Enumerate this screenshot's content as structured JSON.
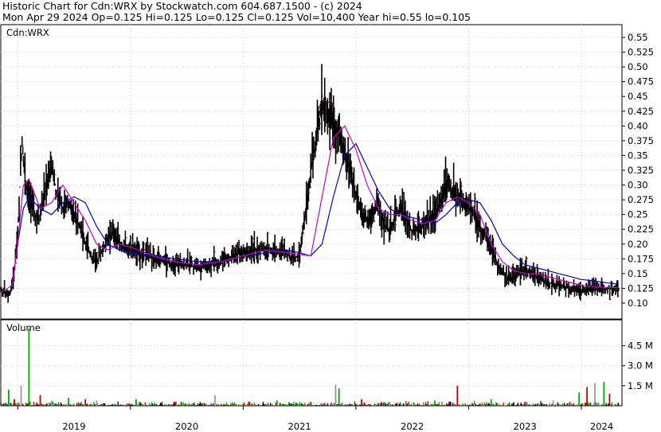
{
  "header": {
    "line1": "Historic Chart for Cdn:WRX by Stockwatch.com 604.687.1500 - (c) 2024",
    "line2": "Mon Apr 29 2024   Op=0.125  Hi=0.125  Lo=0.125  Cl=0.125  Vol=10,400  Year hi=0.55  lo=0.105"
  },
  "colors": {
    "background": "#ffffff",
    "grid": "#c8c8c8",
    "bar_up": "#000000",
    "bar_close": "#cc0000",
    "ma_short": "#cc00cc",
    "ma_long": "#0000cc",
    "vol_up": "#00aa00",
    "vol_down": "#cc0000",
    "vol_flat": "#999999"
  },
  "chart_data": [
    {
      "type": "line",
      "legend_label": "Cdn:WRX",
      "y_ticks": [
        "0.55",
        "0.525",
        "0.50",
        "0.475",
        "0.45",
        "0.425",
        "0.40",
        "0.375",
        "0.35",
        "0.325",
        "0.30",
        "0.275",
        "0.25",
        "0.225",
        "0.20",
        "0.175",
        "0.15",
        "0.125",
        "0.10"
      ],
      "ylim": [
        0.09,
        0.565
      ],
      "x_ticks": [
        "2019",
        "2020",
        "2021",
        "2022",
        "2023",
        "2024"
      ],
      "xlim": [
        2018.85,
        2024.36
      ],
      "grid": true,
      "price_series": {
        "x": [
          2018.85,
          2018.93,
          2018.97,
          2019.0,
          2019.02,
          2019.04,
          2019.06,
          2019.09,
          2019.12,
          2019.15,
          2019.2,
          2019.25,
          2019.3,
          2019.35,
          2019.4,
          2019.45,
          2019.5,
          2019.55,
          2019.6,
          2019.65,
          2019.7,
          2019.75,
          2019.8,
          2019.85,
          2019.9,
          2019.95,
          2020.0,
          2020.05,
          2020.1,
          2020.15,
          2020.2,
          2020.3,
          2020.4,
          2020.5,
          2020.6,
          2020.7,
          2020.8,
          2020.9,
          2021.0,
          2021.1,
          2021.2,
          2021.3,
          2021.35,
          2021.4,
          2021.45,
          2021.5,
          2021.6,
          2021.7,
          2021.8,
          2021.85,
          2021.9,
          2021.95,
          2021.98,
          2022.02,
          2022.05,
          2022.1,
          2022.15,
          2022.2,
          2022.25,
          2022.3,
          2022.35,
          2022.4,
          2022.5,
          2022.6,
          2022.7,
          2022.8,
          2022.9,
          2023.0,
          2023.05,
          2023.1,
          2023.15,
          2023.2,
          2023.25,
          2023.3,
          2023.35,
          2023.4,
          2023.45,
          2023.5,
          2023.55,
          2023.6,
          2023.65,
          2023.7,
          2023.8,
          2023.9,
          2024.0,
          2024.1,
          2024.2,
          2024.3,
          2024.33
        ],
        "y": [
          0.12,
          0.115,
          0.15,
          0.22,
          0.3,
          0.38,
          0.32,
          0.28,
          0.27,
          0.25,
          0.24,
          0.3,
          0.33,
          0.28,
          0.26,
          0.27,
          0.25,
          0.23,
          0.2,
          0.18,
          0.17,
          0.19,
          0.21,
          0.22,
          0.2,
          0.19,
          0.19,
          0.185,
          0.18,
          0.18,
          0.175,
          0.17,
          0.165,
          0.165,
          0.16,
          0.165,
          0.17,
          0.18,
          0.185,
          0.19,
          0.19,
          0.185,
          0.19,
          0.18,
          0.175,
          0.18,
          0.32,
          0.44,
          0.4,
          0.38,
          0.35,
          0.33,
          0.3,
          0.27,
          0.25,
          0.24,
          0.25,
          0.27,
          0.23,
          0.22,
          0.25,
          0.26,
          0.22,
          0.23,
          0.25,
          0.3,
          0.28,
          0.26,
          0.25,
          0.23,
          0.21,
          0.19,
          0.17,
          0.15,
          0.14,
          0.145,
          0.15,
          0.155,
          0.15,
          0.145,
          0.14,
          0.135,
          0.13,
          0.125,
          0.12,
          0.125,
          0.125,
          0.125,
          0.125
        ]
      },
      "ma_short": {
        "x": [
          2018.85,
          2018.95,
          2019.0,
          2019.05,
          2019.1,
          2019.2,
          2019.3,
          2019.4,
          2019.5,
          2019.6,
          2019.7,
          2019.8,
          2019.9,
          2020.0,
          2020.2,
          2020.4,
          2020.6,
          2020.8,
          2021.0,
          2021.2,
          2021.4,
          2021.6,
          2021.7,
          2021.8,
          2021.9,
          2022.0,
          2022.1,
          2022.2,
          2022.3,
          2022.4,
          2022.5,
          2022.6,
          2022.7,
          2022.8,
          2022.9,
          2023.0,
          2023.1,
          2023.2,
          2023.3,
          2023.4,
          2023.5,
          2023.6,
          2023.7,
          2023.8,
          2023.9,
          2024.0,
          2024.1,
          2024.2,
          2024.33
        ],
        "y": [
          0.118,
          0.13,
          0.2,
          0.3,
          0.31,
          0.26,
          0.27,
          0.3,
          0.27,
          0.24,
          0.2,
          0.19,
          0.2,
          0.195,
          0.18,
          0.17,
          0.165,
          0.17,
          0.18,
          0.19,
          0.185,
          0.18,
          0.28,
          0.38,
          0.4,
          0.36,
          0.3,
          0.26,
          0.25,
          0.25,
          0.24,
          0.235,
          0.24,
          0.27,
          0.28,
          0.27,
          0.25,
          0.2,
          0.17,
          0.155,
          0.15,
          0.15,
          0.145,
          0.14,
          0.135,
          0.13,
          0.128,
          0.127,
          0.126
        ]
      },
      "ma_long": {
        "x": [
          2018.95,
          2019.0,
          2019.05,
          2019.1,
          2019.2,
          2019.3,
          2019.4,
          2019.5,
          2019.6,
          2019.7,
          2019.8,
          2019.9,
          2020.0,
          2020.2,
          2020.4,
          2020.6,
          2020.8,
          2021.0,
          2021.2,
          2021.4,
          2021.6,
          2021.7,
          2021.8,
          2021.9,
          2022.0,
          2022.1,
          2022.2,
          2022.3,
          2022.4,
          2022.5,
          2022.6,
          2022.7,
          2022.8,
          2022.9,
          2023.0,
          2023.1,
          2023.2,
          2023.3,
          2023.4,
          2023.5,
          2023.6,
          2023.7,
          2023.8,
          2023.9,
          2024.0,
          2024.1,
          2024.2,
          2024.33
        ],
        "y": [
          0.13,
          0.2,
          0.26,
          0.28,
          0.26,
          0.25,
          0.27,
          0.28,
          0.27,
          0.23,
          0.2,
          0.19,
          0.185,
          0.18,
          0.175,
          0.17,
          0.17,
          0.18,
          0.185,
          0.19,
          0.18,
          0.2,
          0.28,
          0.35,
          0.37,
          0.33,
          0.29,
          0.26,
          0.25,
          0.245,
          0.24,
          0.235,
          0.25,
          0.27,
          0.275,
          0.27,
          0.24,
          0.2,
          0.18,
          0.165,
          0.16,
          0.155,
          0.15,
          0.145,
          0.14,
          0.138,
          0.135,
          0.132
        ]
      }
    },
    {
      "type": "bar",
      "legend_label": "Volume",
      "y_ticks": [
        "4.5 M",
        "3.0 M",
        "1.5 M"
      ],
      "ylim": [
        0,
        6.0
      ],
      "x_ticks": [
        "2019",
        "2020",
        "2021",
        "2022",
        "2023",
        "2024"
      ],
      "grid": true,
      "spikes": {
        "x": [
          2018.92,
          2018.97,
          2019.03,
          2019.1,
          2019.2,
          2019.3,
          2019.45,
          2019.6,
          2019.7,
          2020.05,
          2020.4,
          2020.75,
          2021.3,
          2021.6,
          2021.82,
          2021.85,
          2022.05,
          2022.3,
          2022.7,
          2022.9,
          2023.05,
          2023.2,
          2023.5,
          2023.75,
          2023.98,
          2024.05,
          2024.12,
          2024.2,
          2024.25
        ],
        "values": [
          1.2,
          0.5,
          1.5,
          5.8,
          0.8,
          0.4,
          0.6,
          0.5,
          0.4,
          0.5,
          0.3,
          0.8,
          0.4,
          0.3,
          1.6,
          1.3,
          0.5,
          0.3,
          0.4,
          1.5,
          0.4,
          0.5,
          0.3,
          0.4,
          1.0,
          1.4,
          1.7,
          1.8,
          0.9
        ]
      }
    }
  ]
}
